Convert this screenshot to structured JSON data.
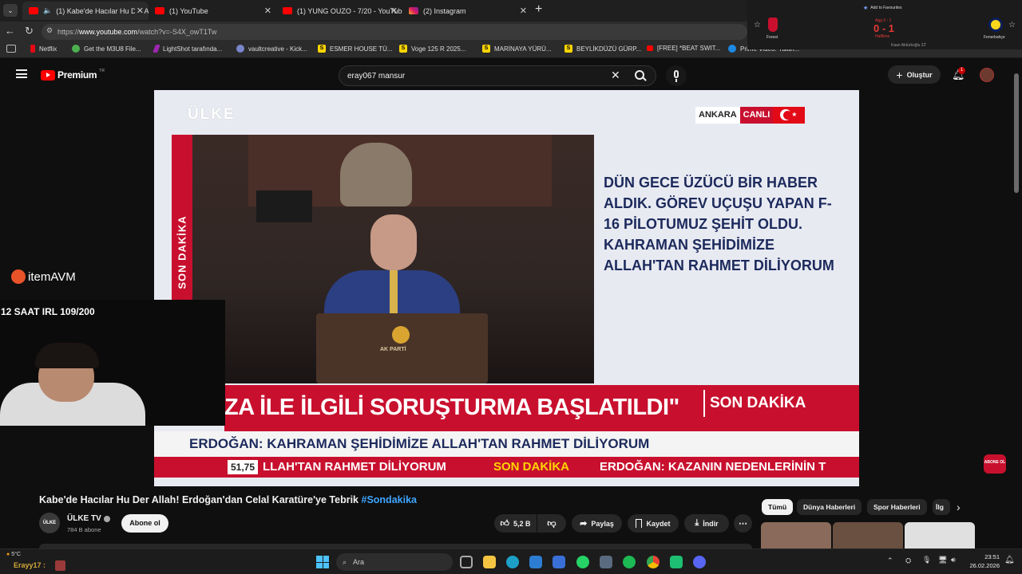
{
  "browser": {
    "tabs": [
      {
        "label": "(1) Kabe'de Hacılar Hu Der All",
        "active": true
      },
      {
        "label": "(1) YouTube"
      },
      {
        "label": "(1) YUNG OUZO - 7/20 - YouTube"
      },
      {
        "label": "(2) Instagram"
      }
    ],
    "url_prefix": "https://",
    "url_host": "www.youtube.com",
    "url_path": "/watch?v=-S4X_owT1Tw",
    "bookmarks": [
      "Netflix",
      "Get the M3U8 File...",
      "LightShot tarafında...",
      "vaultcreative - Kick...",
      "ESMER HOUSE TÜ...",
      "Voge 125 R 2025...",
      "MARİNAYA YÜRÜ...",
      "BEYLİKDÜZÜ GÜRP...",
      "[FREE] *BEAT SWIT...",
      "Prime Video: Yalan..."
    ]
  },
  "score_widget": {
    "add_fav": "Add to Favourites",
    "home": "Forest",
    "away": "Fenerbahçe",
    "score": "0 - 1",
    "status": "Halftime",
    "agg": "Agg 3 - 1",
    "scorer": "Kaan Aktürkoğlu 22'"
  },
  "youtube": {
    "brand": "Premium",
    "brand_sup": "TR",
    "search_value": "eray067 mansur",
    "create_label": "Oluştur",
    "notif_count": "1"
  },
  "video": {
    "channel_logo": "ÜLKE",
    "location": "ANKARA",
    "live": "CANLI",
    "side_text": "SON DAKİKA",
    "quote": "DÜN GECE ÜZÜCÜ BİR HABER ALDIK. GÖREV UÇUŞU YAPAN F-16 PİLOTUMUZ ŞEHİT OLDU. KAHRAMAN ŞEHİDİMİZE ALLAH'TAN RAHMET DİLİYORUM",
    "headline": "ZA İLE İLGİLİ SORUŞTURMA BAŞLATILDI\"",
    "headline_tag": "SON DAKİKA",
    "subline": "ERDOĞAN: KAHRAMAN ŞEHİDİMİZE ALLAH'TAN RAHMET DİLİYORUM",
    "ticker_value": "51,75",
    "ticker_1": "LLAH'TAN RAHMET DİLİYORUM",
    "ticker_2": "SON DAKİKA",
    "ticker_3": "ERDOĞAN: KAZANIN NEDENLERİNİN T",
    "podium_text": "AK PARTİ"
  },
  "overlay": {
    "sponsor": "itemAVM",
    "stream_label": "12 SAAT IRL 109/200",
    "abone": "ABONE OL"
  },
  "meta": {
    "title": "Kabe'de Hacılar Hu Der Allah! Erdoğan'dan Celal Karatüre'ye Tebrik",
    "hashtag": "#Sondakika",
    "channel": "ÜLKE TV",
    "subscribers": "784 B abone",
    "subscribe": "Abone ol",
    "likes": "5,2 B",
    "share": "Paylaş",
    "save": "Kaydet",
    "download": "İndir"
  },
  "chips": [
    "Tümü",
    "Dünya Haberleri",
    "Spor Haberleri",
    "İlg"
  ],
  "taskbar": {
    "weather": "5°C",
    "user_label": "Erayy17 :",
    "search": "Ara",
    "time": "23:51",
    "date": "26.02.2026"
  }
}
